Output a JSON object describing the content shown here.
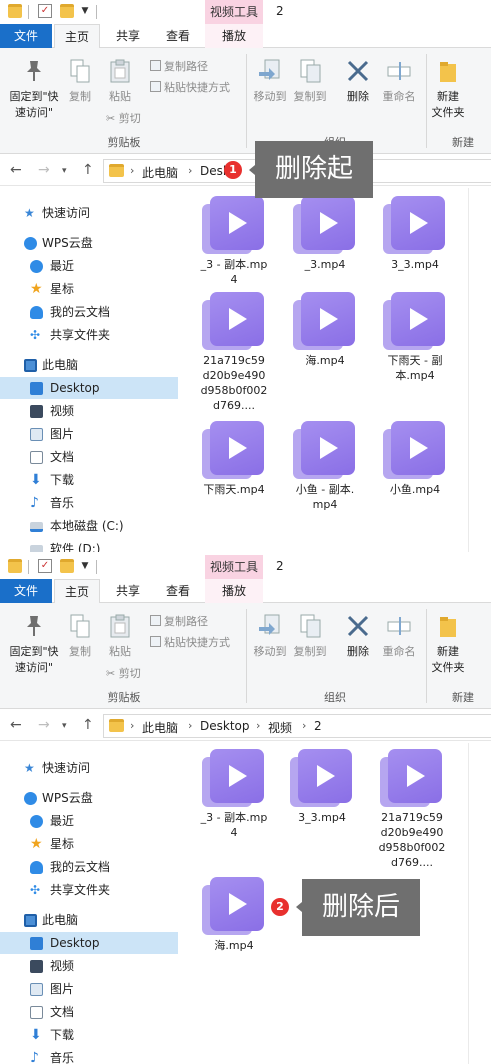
{
  "ribbon": {
    "context_tab_label": "视频工具",
    "window_title": "2",
    "tabs": {
      "file": "文件",
      "home": "主页",
      "share": "共享",
      "view": "查看",
      "play": "播放"
    },
    "pin_label_line1": "固定到\"快",
    "pin_label_line2": "速访问\"",
    "copy_label": "复制",
    "paste_label": "粘贴",
    "copy_path_label": "复制路径",
    "paste_shortcut_label": "粘贴快捷方式",
    "cut_label": "剪切",
    "clipboard_group": "剪贴板",
    "move_to_label": "移动到",
    "copy_to_label": "复制到",
    "delete_label": "删除",
    "rename_label": "重命名",
    "organize_group": "组织",
    "new_folder_line1": "新建",
    "new_folder_line2": "文件夹",
    "new_group": "新建"
  },
  "nav_pane": {
    "quick_access": "快速访问",
    "wps_cloud": "WPS云盘",
    "recent": "最近",
    "starred": "星标",
    "my_cloud_docs": "我的云文档",
    "shared_folders": "共享文件夹",
    "this_pc": "此电脑",
    "desktop": "Desktop",
    "videos": "视频",
    "pictures": "图片",
    "documents": "文档",
    "downloads": "下载",
    "music": "音乐",
    "local_disk_c": "本地磁盘 (C:)",
    "software_d": "软件 (D:)"
  },
  "before": {
    "breadcrumb": {
      "pc": "此电脑",
      "desktop": "Deskt"
    },
    "files": [
      {
        "name": "_3 - 副本.mp4"
      },
      {
        "name": "_3.mp4"
      },
      {
        "name": "3_3.mp4"
      },
      {
        "name": "21a719c59d20b9e490d958b0f002d769...."
      },
      {
        "name": "海.mp4"
      },
      {
        "name": "下雨天 - 副本.mp4"
      },
      {
        "name": "下雨天.mp4"
      },
      {
        "name": "小鱼 - 副本.mp4"
      },
      {
        "name": "小鱼.mp4"
      }
    ],
    "badge": "1",
    "callout": "删除起"
  },
  "after": {
    "breadcrumb": {
      "pc": "此电脑",
      "desktop": "Desktop",
      "videos": "视频",
      "folder": "2"
    },
    "files": [
      {
        "name": "_3 - 副本.mp4"
      },
      {
        "name": "3_3.mp4"
      },
      {
        "name": "21a719c59d20b9e490d958b0f002d769...."
      },
      {
        "name": "海.mp4"
      }
    ],
    "badge": "2",
    "callout": "删除后"
  },
  "colors": {
    "file_tab": "#1a6fc9",
    "context_tab": "#f9d3e2",
    "video_icon": "#8a6fe6",
    "badge": "#e8302e",
    "callout_bg": "#6f6f6f",
    "selected_nav": "#cce4f7"
  },
  "icons": [
    "folder-icon",
    "checklist-icon",
    "pin-icon",
    "copy-icon",
    "paste-icon",
    "scissors-icon",
    "move-to-icon",
    "copy-to-icon",
    "delete-x-icon",
    "rename-icon",
    "new-folder-icon",
    "star-icon",
    "cloud-icon",
    "clock-icon",
    "share-icon",
    "computer-icon",
    "desktop-icon",
    "film-icon",
    "image-icon",
    "document-icon",
    "download-arrow-icon",
    "music-note-icon",
    "drive-icon",
    "video-file-icon"
  ]
}
